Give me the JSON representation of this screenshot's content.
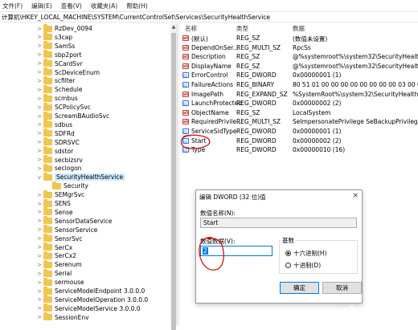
{
  "menu": [
    "文件(F)",
    "编辑(E)",
    "查看(V)",
    "收藏夹(A)",
    "帮助(H)"
  ],
  "address": "计算机\\HKEY_LOCAL_MACHINE\\SYSTEM\\CurrentControlSet\\Services\\SecurityHealthService",
  "tree": [
    {
      "label": "RzDev_0094",
      "expand": ">"
    },
    {
      "label": "s3cap",
      "expand": ">"
    },
    {
      "label": "SamSs",
      "expand": ">"
    },
    {
      "label": "sbp2port",
      "expand": ">"
    },
    {
      "label": "SCardSvr",
      "expand": ">"
    },
    {
      "label": "ScDeviceEnum",
      "expand": ">"
    },
    {
      "label": "scfilter",
      "expand": ">"
    },
    {
      "label": "Schedule",
      "expand": ">"
    },
    {
      "label": "scmbus",
      "expand": ">"
    },
    {
      "label": "SCPolicySvc",
      "expand": ">"
    },
    {
      "label": "ScreamBAudioSvc",
      "expand": ">"
    },
    {
      "label": "sdbus",
      "expand": ">"
    },
    {
      "label": "SDFRd",
      "expand": ">"
    },
    {
      "label": "SDRSVC",
      "expand": ">"
    },
    {
      "label": "sdstor",
      "expand": ">"
    },
    {
      "label": "secbizsrv",
      "expand": ">"
    },
    {
      "label": "seclogon",
      "expand": ">"
    },
    {
      "label": "SecurityHealthService",
      "expand": "v"
    },
    {
      "label": "Security",
      "expand": ""
    },
    {
      "label": "SEMgrSvc",
      "expand": ">"
    },
    {
      "label": "SENS",
      "expand": ">"
    },
    {
      "label": "Sense",
      "expand": ">"
    },
    {
      "label": "SensorDataService",
      "expand": ">"
    },
    {
      "label": "SensorService",
      "expand": ">"
    },
    {
      "label": "SensrSvc",
      "expand": ">"
    },
    {
      "label": "SerCx",
      "expand": ">"
    },
    {
      "label": "SerCx2",
      "expand": ">"
    },
    {
      "label": "Serenum",
      "expand": ">"
    },
    {
      "label": "Serial",
      "expand": ">"
    },
    {
      "label": "sermouse",
      "expand": ">"
    },
    {
      "label": "ServiceModelEndpoint 3.0.0.0",
      "expand": ">"
    },
    {
      "label": "ServiceModelOperation 3.0.0.0",
      "expand": ">"
    },
    {
      "label": "ServiceModelService 3.0.0.0",
      "expand": ">"
    },
    {
      "label": "SessionEnv",
      "expand": ">"
    }
  ],
  "values_header": {
    "name": "名称",
    "type": "类型",
    "data": "数据"
  },
  "values": [
    {
      "icon": "ab",
      "name": "(默认)",
      "type": "REG_SZ",
      "data": "(数值未设置)"
    },
    {
      "icon": "ab",
      "name": "DependOnSer...",
      "type": "REG_MULTI_SZ",
      "data": "RpcSs"
    },
    {
      "icon": "ab",
      "name": "Description",
      "type": "REG_SZ",
      "data": "@%systemroot%\\system32\\SecurityHealthAg..."
    },
    {
      "icon": "ab",
      "name": "DisplayName",
      "type": "REG_SZ",
      "data": "@%systemroot%\\system32\\SecurityHealthAg..."
    },
    {
      "icon": "011",
      "name": "ErrorControl",
      "type": "REG_DWORD",
      "data": "0x00000001 (1)"
    },
    {
      "icon": "011",
      "name": "FailureActions",
      "type": "REG_BINARY",
      "data": "80 51 01 00 00 00 00 00 00 00 00 03 00 00..."
    },
    {
      "icon": "ab",
      "name": "ImagePath",
      "type": "REG_EXPAND_SZ",
      "data": "%SystemRoot%\\system32\\SecurityHealthServi..."
    },
    {
      "icon": "011",
      "name": "LaunchProtected",
      "type": "REG_DWORD",
      "data": "0x00000002 (2)"
    },
    {
      "icon": "ab",
      "name": "ObjectName",
      "type": "REG_SZ",
      "data": "LocalSystem"
    },
    {
      "icon": "ab",
      "name": "RequiredPrivile...",
      "type": "REG_MULTI_SZ",
      "data": "SeImpersonatePrivilege SeBackupPrivilege Se..."
    },
    {
      "icon": "011",
      "name": "ServiceSidType",
      "type": "REG_DWORD",
      "data": "0x00000001 (1)"
    },
    {
      "icon": "011",
      "name": "Start",
      "type": "REG_DWORD",
      "data": "0x00000002 (2)"
    },
    {
      "icon": "011",
      "name": "Type",
      "type": "REG_DWORD",
      "data": "0x00000010 (16)"
    }
  ],
  "dialog": {
    "title": "编辑 DWORD (32 位)值",
    "close": "×",
    "name_label": "数值名称(N):",
    "name_value": "Start",
    "data_label": "数值数据(V):",
    "data_value": "2",
    "base_label": "基数",
    "hex_label": "十六进制(H)",
    "dec_label": "十进制(D)",
    "ok": "确定",
    "cancel": "取消"
  },
  "watermark": "chanzai",
  "colors": {
    "selection": "#cce8ff",
    "folder": "#f3c451",
    "annotation": "#d01010",
    "focus": "#0078d7"
  }
}
